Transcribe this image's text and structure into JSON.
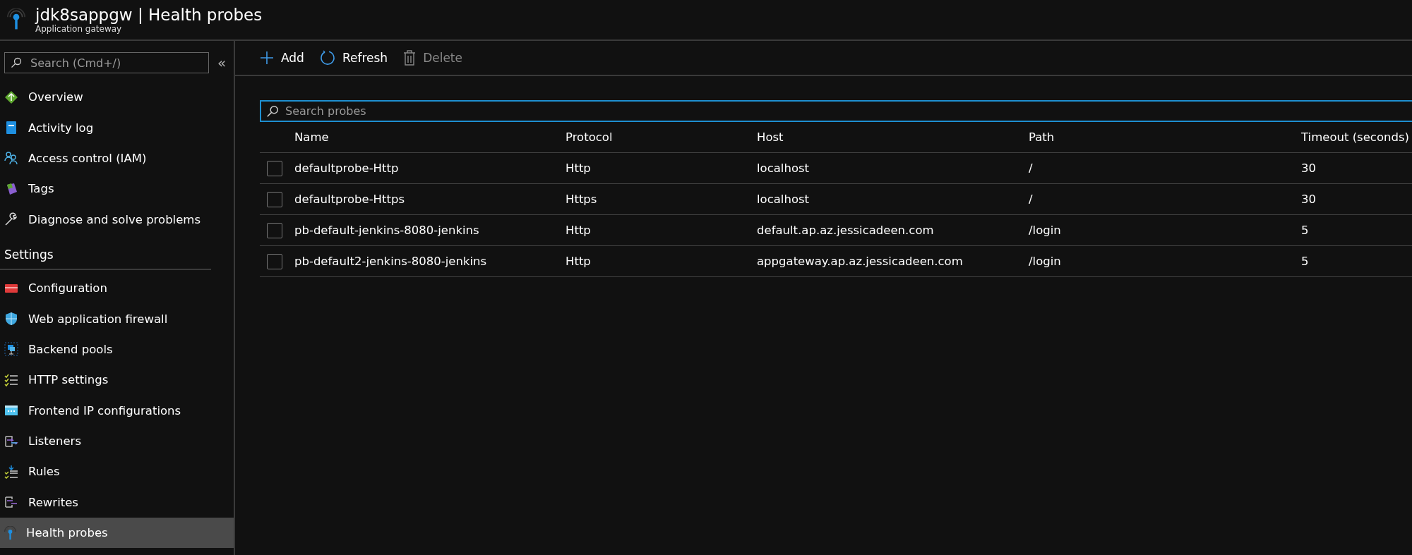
{
  "header": {
    "title": "jdk8sappgw | Health probes",
    "subtitle": "Application gateway"
  },
  "sidebar": {
    "search": {
      "placeholder": "Search (Cmd+/)"
    },
    "collapse": "«",
    "items": [
      {
        "label": "Overview",
        "selected": false
      },
      {
        "label": "Activity log",
        "selected": false
      },
      {
        "label": "Access control (IAM)",
        "selected": false
      },
      {
        "label": "Tags",
        "selected": false
      },
      {
        "label": "Diagnose and solve problems",
        "selected": false
      }
    ],
    "section": "Settings",
    "settings_items": [
      {
        "label": "Configuration",
        "selected": false
      },
      {
        "label": "Web application firewall",
        "selected": false
      },
      {
        "label": "Backend pools",
        "selected": false
      },
      {
        "label": "HTTP settings",
        "selected": false
      },
      {
        "label": "Frontend IP configurations",
        "selected": false
      },
      {
        "label": "Listeners",
        "selected": false
      },
      {
        "label": "Rules",
        "selected": false
      },
      {
        "label": "Rewrites",
        "selected": false
      },
      {
        "label": "Health probes",
        "selected": true
      }
    ]
  },
  "toolbar": [
    {
      "label": "Add",
      "disabled": false
    },
    {
      "label": "Refresh",
      "disabled": false
    },
    {
      "label": "Delete",
      "disabled": true
    }
  ],
  "search": {
    "placeholder": "Search probes"
  },
  "table": {
    "columns": [
      "Name",
      "Protocol",
      "Host",
      "Path",
      "Timeout (seconds)"
    ],
    "rows": [
      {
        "checked": false,
        "cells": [
          "defaultprobe-Http",
          "Http",
          "localhost",
          "/",
          "30"
        ]
      },
      {
        "checked": false,
        "cells": [
          "defaultprobe-Https",
          "Https",
          "localhost",
          "/",
          "30"
        ]
      },
      {
        "checked": false,
        "cells": [
          "pb-default-jenkins-8080-jenkins",
          "Http",
          "default.ap.az.jessicadeen.com",
          "/login",
          "5"
        ]
      },
      {
        "checked": false,
        "cells": [
          "pb-default2-jenkins-8080-jenkins",
          "Http",
          "appgateway.ap.az.jessicadeen.com",
          "/login",
          "5"
        ]
      }
    ]
  }
}
